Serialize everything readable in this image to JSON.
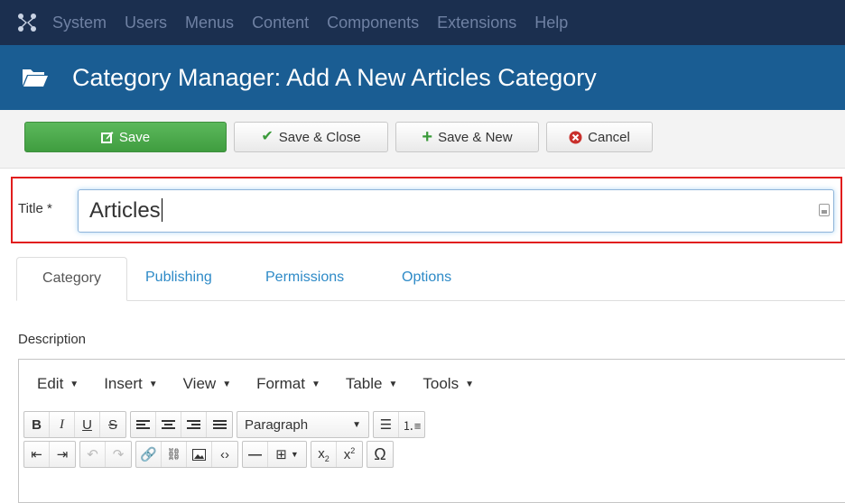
{
  "topnav": {
    "logo_icon": "joomla-logo-icon",
    "items": [
      "System",
      "Users",
      "Menus",
      "Content",
      "Components",
      "Extensions",
      "Help"
    ]
  },
  "header": {
    "icon": "folder-open-icon",
    "title": "Category Manager: Add A New Articles Category"
  },
  "toolbar": {
    "save_label": "Save",
    "save_close_label": "Save & Close",
    "save_new_label": "Save & New",
    "cancel_label": "Cancel"
  },
  "form": {
    "title_label": "Title *",
    "title_value": "Articles"
  },
  "tabs": [
    "Category",
    "Publishing",
    "Permissions",
    "Options"
  ],
  "active_tab": "Category",
  "description": {
    "label": "Description",
    "menu": [
      "Edit",
      "Insert",
      "View",
      "Format",
      "Table",
      "Tools"
    ],
    "format_select": "Paragraph"
  },
  "colors": {
    "nav_bg": "#1b2f4f",
    "header_bg": "#1a5d93",
    "save_green": "#4cae4c",
    "highlight_red": "#e11d1d",
    "link_blue": "#2d8ac7"
  }
}
